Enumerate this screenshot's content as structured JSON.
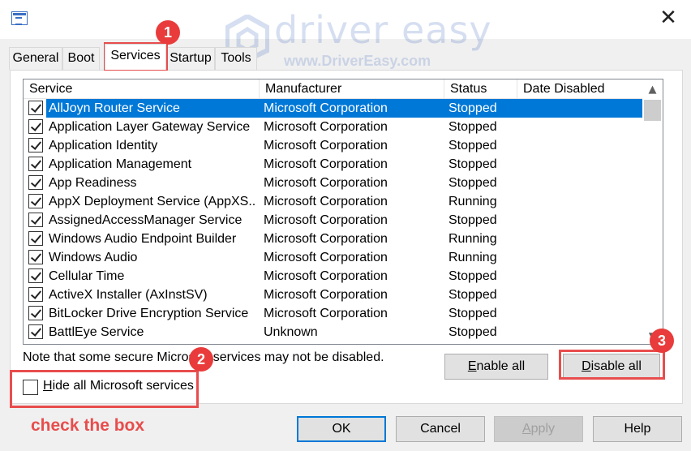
{
  "window": {
    "close_glyph": "✕"
  },
  "watermark": {
    "title": "driver easy",
    "url": "www.DriverEasy.com"
  },
  "tabs": [
    {
      "label": "General"
    },
    {
      "label": "Boot"
    },
    {
      "label": "Services",
      "active": true
    },
    {
      "label": "Startup"
    },
    {
      "label": "Tools"
    }
  ],
  "columns": [
    "Service",
    "Manufacturer",
    "Status",
    "Date Disabled"
  ],
  "services": [
    {
      "name": "AllJoyn Router Service",
      "manufacturer": "Microsoft Corporation",
      "status": "Stopped",
      "date_disabled": "",
      "checked": true,
      "selected": true
    },
    {
      "name": "Application Layer Gateway Service",
      "manufacturer": "Microsoft Corporation",
      "status": "Stopped",
      "date_disabled": "",
      "checked": true
    },
    {
      "name": "Application Identity",
      "manufacturer": "Microsoft Corporation",
      "status": "Stopped",
      "date_disabled": "",
      "checked": true
    },
    {
      "name": "Application Management",
      "manufacturer": "Microsoft Corporation",
      "status": "Stopped",
      "date_disabled": "",
      "checked": true
    },
    {
      "name": "App Readiness",
      "manufacturer": "Microsoft Corporation",
      "status": "Stopped",
      "date_disabled": "",
      "checked": true
    },
    {
      "name": "AppX Deployment Service (AppXS...",
      "manufacturer": "Microsoft Corporation",
      "status": "Running",
      "date_disabled": "",
      "checked": true
    },
    {
      "name": "AssignedAccessManager Service",
      "manufacturer": "Microsoft Corporation",
      "status": "Stopped",
      "date_disabled": "",
      "checked": true
    },
    {
      "name": "Windows Audio Endpoint Builder",
      "manufacturer": "Microsoft Corporation",
      "status": "Running",
      "date_disabled": "",
      "checked": true
    },
    {
      "name": "Windows Audio",
      "manufacturer": "Microsoft Corporation",
      "status": "Running",
      "date_disabled": "",
      "checked": true
    },
    {
      "name": "Cellular Time",
      "manufacturer": "Microsoft Corporation",
      "status": "Stopped",
      "date_disabled": "",
      "checked": true
    },
    {
      "name": "ActiveX Installer (AxInstSV)",
      "manufacturer": "Microsoft Corporation",
      "status": "Stopped",
      "date_disabled": "",
      "checked": true
    },
    {
      "name": "BitLocker Drive Encryption Service",
      "manufacturer": "Microsoft Corporation",
      "status": "Stopped",
      "date_disabled": "",
      "checked": true
    },
    {
      "name": "BattlEye Service",
      "manufacturer": "Unknown",
      "status": "Stopped",
      "date_disabled": "",
      "checked": true
    }
  ],
  "note": "Note that some secure Microsoft services may not be disabled.",
  "buttons": {
    "enable_all": {
      "accel": "E",
      "rest": "nable all"
    },
    "disable_all": {
      "accel": "D",
      "rest": "isable all"
    },
    "ok": "OK",
    "cancel": "Cancel",
    "apply": {
      "accel": "A",
      "rest": "pply"
    },
    "help": "Help"
  },
  "hide_ms": {
    "accel": "H",
    "rest": "ide all Microsoft services",
    "checked": false
  },
  "annotations": {
    "badge1": "1",
    "badge2": "2",
    "badge3": "3",
    "instruction": "check the box",
    "color": "#e84d4d"
  },
  "colors": {
    "selection": "#0078d7",
    "annotation": "#e84d4d"
  },
  "icons": {
    "app": "msconfig-icon",
    "close": "close-icon",
    "scroll_up": "chevron-up-icon",
    "scroll_down": "chevron-down-icon"
  }
}
